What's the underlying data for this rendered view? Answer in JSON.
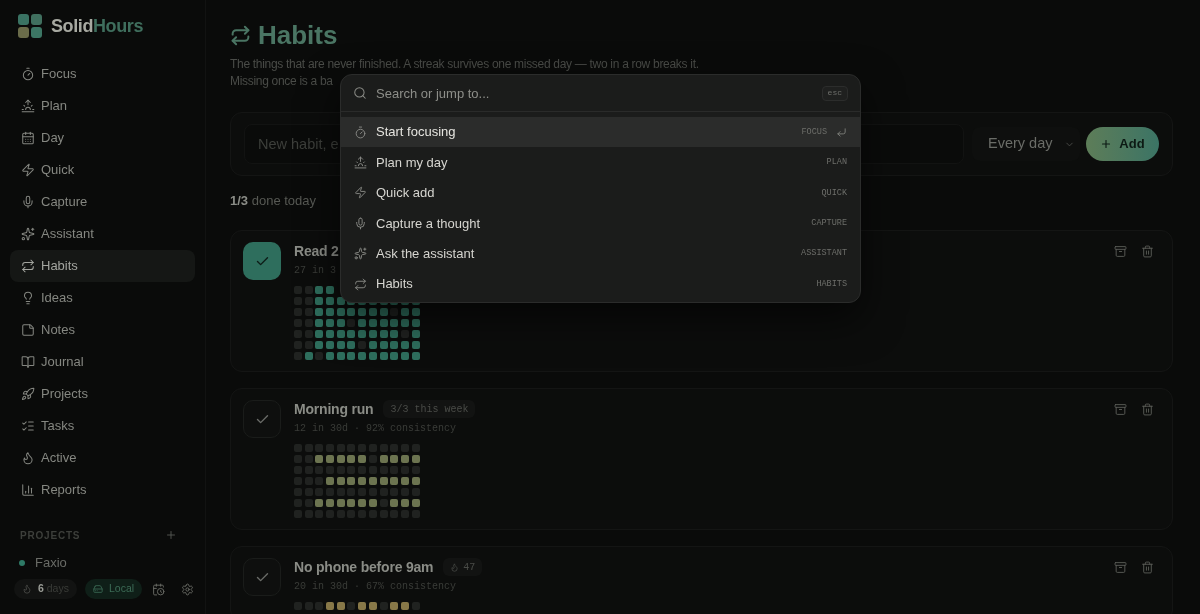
{
  "sidebar": {
    "brand": [
      "Solid",
      "Hours"
    ],
    "nav": [
      {
        "label": "Focus",
        "selected": false
      },
      {
        "label": "Plan",
        "selected": false
      },
      {
        "label": "Day",
        "selected": false
      },
      {
        "label": "Quick",
        "selected": false
      },
      {
        "label": "Capture",
        "selected": false
      },
      {
        "label": "Assistant",
        "selected": false
      },
      {
        "label": "Habits",
        "selected": true
      },
      {
        "label": "Ideas",
        "selected": false
      },
      {
        "label": "Notes",
        "selected": false
      },
      {
        "label": "Journal",
        "selected": false
      },
      {
        "label": "Projects",
        "selected": false
      },
      {
        "label": "Tasks",
        "selected": false
      },
      {
        "label": "Active",
        "selected": false
      },
      {
        "label": "Reports",
        "selected": false
      }
    ],
    "projects_heading": "PROJECTS",
    "projects": [
      {
        "name": "Faxio",
        "color": "#2e7a66"
      }
    ],
    "footer": {
      "streak": "**6** days",
      "storage": "Local"
    }
  },
  "header": {
    "title": "Habits",
    "description": [
      "The things that are never finished. A streak survives one missed day — two in a row breaks it.",
      "Missing once is a ba"
    ]
  },
  "new_habit": {
    "placeholder": "New habit, e",
    "frequency": "Every day",
    "add_label": "Add"
  },
  "summary": "**1/3** done today",
  "habits": [
    {
      "title": "Read 2",
      "done": true,
      "color": "#2e6e5d",
      "stats": "27 in 3",
      "heatmap": [
        [
          false,
          false,
          true,
          true
        ],
        [
          false,
          false,
          true,
          true,
          true,
          true,
          true,
          true,
          true,
          true,
          true,
          true
        ],
        [
          false,
          false,
          true,
          true,
          true,
          true,
          true,
          true,
          true,
          false,
          true,
          true
        ],
        [
          false,
          false,
          true,
          true,
          true,
          false,
          true,
          true,
          true,
          true,
          true,
          true
        ],
        [
          false,
          false,
          true,
          true,
          true,
          true,
          true,
          true,
          true,
          true,
          false,
          true
        ],
        [
          false,
          false,
          true,
          true,
          true,
          true,
          false,
          true,
          true,
          true,
          true,
          true
        ],
        [
          false,
          true,
          false,
          true,
          true,
          true,
          true,
          true,
          true,
          true,
          true,
          true
        ]
      ]
    },
    {
      "title": "Morning run",
      "done": false,
      "color": "#6c7450",
      "badge": {
        "kind": "week",
        "text": "3/3 this week"
      },
      "stats": "12 in 30d · 92% consistency",
      "heatmap": [
        [
          false,
          false,
          false,
          false,
          false,
          false,
          false,
          false,
          false,
          false,
          false,
          false
        ],
        [
          false,
          false,
          true,
          true,
          true,
          true,
          true,
          false,
          true,
          true,
          true,
          true
        ],
        [
          false,
          false,
          false,
          false,
          false,
          false,
          false,
          false,
          false,
          false,
          false,
          false
        ],
        [
          false,
          false,
          false,
          true,
          true,
          true,
          true,
          true,
          true,
          true,
          true,
          true
        ],
        [
          false,
          false,
          false,
          false,
          false,
          false,
          false,
          false,
          false,
          false,
          false,
          false
        ],
        [
          false,
          false,
          true,
          true,
          true,
          true,
          true,
          true,
          false,
          true,
          true,
          true
        ],
        [
          false,
          false,
          false,
          false,
          false,
          false,
          false,
          false,
          false,
          false,
          false,
          false
        ]
      ]
    },
    {
      "title": "No phone before 9am",
      "done": false,
      "color": "#887848",
      "badge": {
        "kind": "streak",
        "text": "47"
      },
      "stats": "20 in 30d · 67% consistency",
      "heatmap": [
        [
          false,
          false,
          false,
          true,
          true,
          false,
          true,
          true,
          false,
          true,
          true,
          false
        ]
      ]
    }
  ],
  "command_palette": {
    "search_placeholder": "Search or jump to...",
    "close_key": "esc",
    "commands": [
      {
        "label": "Start focusing",
        "hint": "FOCUS",
        "selected": true
      },
      {
        "label": "Plan my day",
        "hint": "PLAN",
        "selected": false
      },
      {
        "label": "Quick add",
        "hint": "QUICK",
        "selected": false
      },
      {
        "label": "Capture a thought",
        "hint": "CAPTURE",
        "selected": false
      },
      {
        "label": "Ask the assistant",
        "hint": "ASSISTANT",
        "selected": false
      },
      {
        "label": "Habits",
        "hint": "HABITS",
        "selected": false
      }
    ]
  }
}
